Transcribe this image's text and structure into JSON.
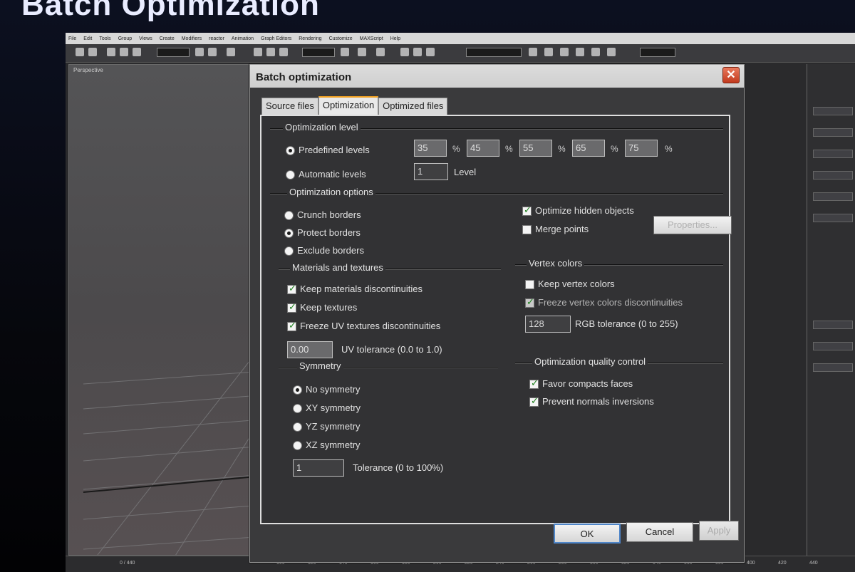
{
  "slide": {
    "title": "Batch Optimization"
  },
  "app": {
    "menu": [
      "File",
      "Edit",
      "Tools",
      "Group",
      "Views",
      "Create",
      "Modifiers",
      "reactor",
      "Animation",
      "Graph Editors",
      "Rendering",
      "Customize",
      "MAXScript",
      "Help"
    ],
    "viewport_label": "Perspective",
    "time_counter": "0 / 440",
    "timeline_ticks": [
      "100",
      "120",
      "140",
      "160",
      "180",
      "200",
      "220",
      "240",
      "260",
      "280",
      "300",
      "320",
      "340",
      "360",
      "380",
      "400",
      "420",
      "440"
    ]
  },
  "dialog": {
    "title": "Batch optimization",
    "close_glyph": "✕",
    "tabs": [
      {
        "label": "Source files",
        "active": false
      },
      {
        "label": "Optimization",
        "active": true
      },
      {
        "label": "Optimized files",
        "active": false
      }
    ],
    "optimization_level": {
      "label": "Optimization level",
      "predefined": {
        "label": "Predefined levels",
        "selected": true
      },
      "levels": [
        "35",
        "45",
        "55",
        "65",
        "75"
      ],
      "percent": "%",
      "automatic": {
        "label": "Automatic levels",
        "selected": false
      },
      "auto_value": "1",
      "auto_unit": "Level"
    },
    "optimization_options": {
      "label": "Optimization options",
      "crunch": {
        "label": "Crunch borders",
        "selected": false
      },
      "protect": {
        "label": "Protect borders",
        "selected": true
      },
      "exclude": {
        "label": "Exclude borders",
        "selected": false
      },
      "optimize_hidden": {
        "label": "Optimize hidden objects",
        "checked": true
      },
      "merge_points": {
        "label": "Merge points",
        "checked": false
      },
      "properties_button": "Properties..."
    },
    "materials": {
      "label": "Materials and textures",
      "keep_materials": {
        "label": "Keep materials discontinuities",
        "checked": true
      },
      "keep_textures": {
        "label": "Keep textures",
        "checked": true
      },
      "freeze_uv": {
        "label": "Freeze UV textures discontinuities",
        "checked": true
      },
      "uv_tolerance_value": "0.00",
      "uv_tolerance_label": "UV tolerance (0.0 to 1.0)"
    },
    "vertex_colors": {
      "label": "Vertex colors",
      "keep": {
        "label": "Keep vertex colors",
        "checked": false
      },
      "freeze": {
        "label": "Freeze vertex colors discontinuities",
        "checked": true
      },
      "rgb_value": "128",
      "rgb_label": "RGB tolerance (0 to 255)"
    },
    "symmetry": {
      "label": "Symmetry",
      "options": [
        {
          "label": "No symmetry",
          "selected": true
        },
        {
          "label": "XY symmetry",
          "selected": false
        },
        {
          "label": "YZ symmetry",
          "selected": false
        },
        {
          "label": "XZ symmetry",
          "selected": false
        }
      ],
      "tolerance_value": "1",
      "tolerance_label": "Tolerance (0 to 100%)"
    },
    "quality": {
      "label": "Optimization quality control",
      "favor": {
        "label": "Favor compacts faces",
        "checked": true
      },
      "prevent": {
        "label": "Prevent normals inversions",
        "checked": true
      }
    },
    "buttons": {
      "ok": "OK",
      "cancel": "Cancel",
      "apply": "Apply"
    }
  }
}
